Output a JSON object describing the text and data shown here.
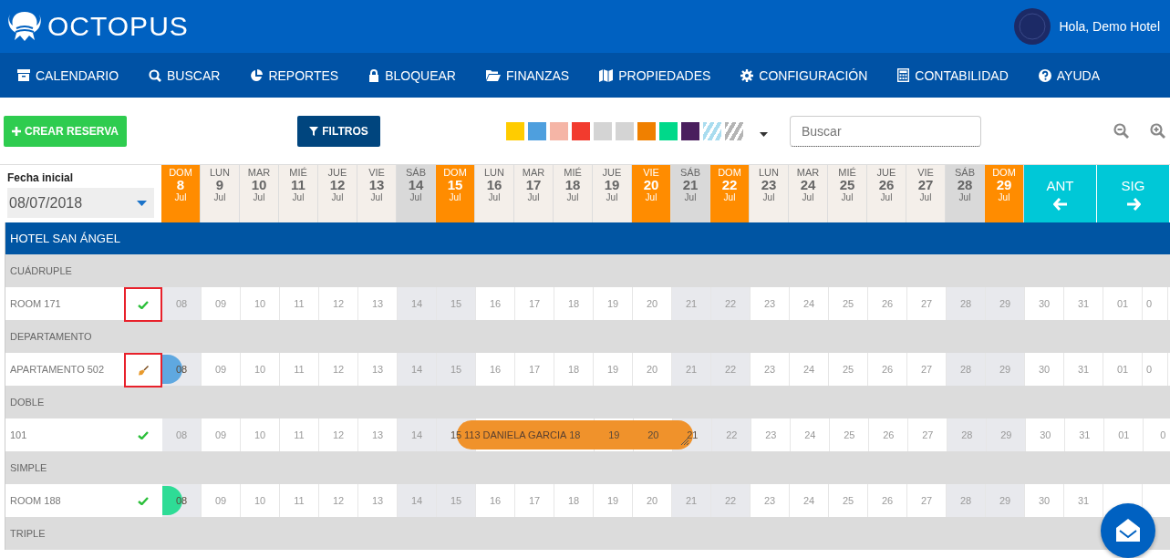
{
  "header": {
    "brand": "OCTOPUS",
    "greeting": "Hola, Demo Hotel"
  },
  "nav": [
    {
      "label": "CALENDARIO"
    },
    {
      "label": "BUSCAR"
    },
    {
      "label": "REPORTES"
    },
    {
      "label": "BLOQUEAR"
    },
    {
      "label": "FINANZAS"
    },
    {
      "label": "PROPIEDADES"
    },
    {
      "label": "CONFIGURACIÓN"
    },
    {
      "label": "CONTABILIDAD"
    },
    {
      "label": "AYUDA"
    }
  ],
  "toolbar": {
    "create_button": "CREAR RESERVA",
    "filter_button": "FILTROS",
    "search": {
      "placeholder": "Buscar"
    },
    "swatches": [
      {
        "kind": "solid",
        "color": "#ffcc00"
      },
      {
        "kind": "solid",
        "color": "#4e9fde"
      },
      {
        "kind": "solid",
        "color": "#f5b5a6"
      },
      {
        "kind": "solid",
        "color": "#f23b2e"
      },
      {
        "kind": "solid",
        "color": "#d4d4d4"
      },
      {
        "kind": "solid",
        "color": "#d4d4d4"
      },
      {
        "kind": "solid",
        "color": "#f08000"
      },
      {
        "kind": "solid",
        "color": "#00d98a"
      },
      {
        "kind": "solid",
        "color": "#4a1f5e"
      },
      {
        "kind": "striped",
        "color": "#a9dcef"
      },
      {
        "kind": "striped",
        "color": "#b4b4b4"
      }
    ]
  },
  "date_picker": {
    "label": "Fecha inicial",
    "value": "08/07/2018"
  },
  "days": [
    {
      "weekday": "DOM",
      "day": "8",
      "month": "Jul",
      "kind": "sunday"
    },
    {
      "weekday": "LUN",
      "day": "9",
      "month": "Jul",
      "kind": "weekday"
    },
    {
      "weekday": "MAR",
      "day": "10",
      "month": "Jul",
      "kind": "weekday"
    },
    {
      "weekday": "MIÉ",
      "day": "11",
      "month": "Jul",
      "kind": "weekday"
    },
    {
      "weekday": "JUE",
      "day": "12",
      "month": "Jul",
      "kind": "weekday"
    },
    {
      "weekday": "VIE",
      "day": "13",
      "month": "Jul",
      "kind": "weekday"
    },
    {
      "weekday": "SÁB",
      "day": "14",
      "month": "Jul",
      "kind": "saturday"
    },
    {
      "weekday": "DOM",
      "day": "15",
      "month": "Jul",
      "kind": "sunday"
    },
    {
      "weekday": "LUN",
      "day": "16",
      "month": "Jul",
      "kind": "weekday"
    },
    {
      "weekday": "MAR",
      "day": "17",
      "month": "Jul",
      "kind": "weekday"
    },
    {
      "weekday": "MIÉ",
      "day": "18",
      "month": "Jul",
      "kind": "weekday"
    },
    {
      "weekday": "JUE",
      "day": "19",
      "month": "Jul",
      "kind": "weekday"
    },
    {
      "weekday": "VIE",
      "day": "20",
      "month": "Jul",
      "kind": "holiday"
    },
    {
      "weekday": "SÁB",
      "day": "21",
      "month": "Jul",
      "kind": "saturday"
    },
    {
      "weekday": "DOM",
      "day": "22",
      "month": "Jul",
      "kind": "sunday"
    },
    {
      "weekday": "LUN",
      "day": "23",
      "month": "Jul",
      "kind": "weekday"
    },
    {
      "weekday": "MAR",
      "day": "24",
      "month": "Jul",
      "kind": "weekday"
    },
    {
      "weekday": "MIÉ",
      "day": "25",
      "month": "Jul",
      "kind": "weekday"
    },
    {
      "weekday": "JUE",
      "day": "26",
      "month": "Jul",
      "kind": "weekday"
    },
    {
      "weekday": "VIE",
      "day": "27",
      "month": "Jul",
      "kind": "weekday"
    },
    {
      "weekday": "SÁB",
      "day": "28",
      "month": "Jul",
      "kind": "saturday"
    },
    {
      "weekday": "DOM",
      "day": "29",
      "month": "Jul",
      "kind": "sunday"
    }
  ],
  "prev_button": "ANT",
  "next_button": "SIG",
  "hotel": {
    "name": "HOTEL SAN ÁNGEL"
  },
  "groups": [
    {
      "category": "CUÁDRUPLE",
      "rooms": [
        {
          "name": "ROOM 171",
          "clean": true,
          "highlighted": true,
          "cells": [
            {
              "kind": "day",
              "text": "08",
              "shaded": true
            },
            {
              "kind": "day",
              "text": "09",
              "shaded": false
            },
            {
              "kind": "day",
              "text": "10",
              "shaded": false
            },
            {
              "kind": "day",
              "text": "11",
              "shaded": false
            },
            {
              "kind": "day",
              "text": "12",
              "shaded": false
            },
            {
              "kind": "day",
              "text": "13",
              "shaded": false
            },
            {
              "kind": "day",
              "text": "14",
              "shaded": true
            },
            {
              "kind": "day",
              "text": "15",
              "shaded": true
            },
            {
              "kind": "day",
              "text": "16",
              "shaded": false
            },
            {
              "kind": "day",
              "text": "17",
              "shaded": false
            },
            {
              "kind": "day",
              "text": "18",
              "shaded": false
            },
            {
              "kind": "day",
              "text": "19",
              "shaded": false
            },
            {
              "kind": "day",
              "text": "20",
              "shaded": false
            },
            {
              "kind": "day",
              "text": "21",
              "shaded": true
            },
            {
              "kind": "day",
              "text": "22",
              "shaded": true
            },
            {
              "kind": "day",
              "text": "23",
              "shaded": false
            },
            {
              "kind": "day",
              "text": "24",
              "shaded": false
            },
            {
              "kind": "day",
              "text": "25",
              "shaded": false
            },
            {
              "kind": "day",
              "text": "26",
              "shaded": false
            },
            {
              "kind": "day",
              "text": "27",
              "shaded": false
            },
            {
              "kind": "day",
              "text": "28",
              "shaded": true
            },
            {
              "kind": "day",
              "text": "29",
              "shaded": true
            },
            {
              "kind": "day",
              "text": "30",
              "shaded": false
            },
            {
              "kind": "day",
              "text": "31",
              "shaded": false
            },
            {
              "kind": "day",
              "text": "01",
              "shaded": false
            },
            {
              "kind": "day",
              "text": "0",
              "shaded": false
            }
          ]
        }
      ]
    },
    {
      "category": "DEPARTAMENTO",
      "rooms": [
        {
          "name": "APARTAMENTO 502",
          "clean": false,
          "highlighted": true,
          "cells": [
            {
              "kind": "booking",
              "color": "#5fa8e0",
              "from_before": true,
              "days": [
                {
                  "kind": "day",
                  "text": "08",
                  "shaded": true
                }
              ]
            },
            {
              "kind": "day",
              "text": "09",
              "shaded": false
            },
            {
              "kind": "day",
              "text": "10",
              "shaded": false
            },
            {
              "kind": "day",
              "text": "11",
              "shaded": false
            },
            {
              "kind": "day",
              "text": "12",
              "shaded": false
            },
            {
              "kind": "day",
              "text": "13",
              "shaded": false
            },
            {
              "kind": "day",
              "text": "14",
              "shaded": true
            },
            {
              "kind": "day",
              "text": "15",
              "shaded": true
            },
            {
              "kind": "day",
              "text": "16",
              "shaded": false
            },
            {
              "kind": "day",
              "text": "17",
              "shaded": false
            },
            {
              "kind": "day",
              "text": "18",
              "shaded": false
            },
            {
              "kind": "day",
              "text": "19",
              "shaded": false
            },
            {
              "kind": "day",
              "text": "20",
              "shaded": false
            },
            {
              "kind": "day",
              "text": "21",
              "shaded": true
            },
            {
              "kind": "day",
              "text": "22",
              "shaded": true
            },
            {
              "kind": "day",
              "text": "23",
              "shaded": false
            },
            {
              "kind": "day",
              "text": "24",
              "shaded": false
            },
            {
              "kind": "day",
              "text": "25",
              "shaded": false
            },
            {
              "kind": "day",
              "text": "26",
              "shaded": false
            },
            {
              "kind": "day",
              "text": "27",
              "shaded": false
            },
            {
              "kind": "day",
              "text": "28",
              "shaded": true
            },
            {
              "kind": "day",
              "text": "29",
              "shaded": true
            },
            {
              "kind": "day",
              "text": "30",
              "shaded": false
            },
            {
              "kind": "day",
              "text": "31",
              "shaded": false
            },
            {
              "kind": "day",
              "text": "01",
              "shaded": false
            },
            {
              "kind": "day",
              "text": "0",
              "shaded": false
            }
          ]
        }
      ]
    },
    {
      "category": "DOBLE",
      "rooms": [
        {
          "name": "101",
          "clean": true,
          "highlighted": false,
          "cells": [
            {
              "kind": "day",
              "text": "08",
              "shaded": true
            },
            {
              "kind": "day",
              "text": "09",
              "shaded": false
            },
            {
              "kind": "day",
              "text": "10",
              "shaded": false
            },
            {
              "kind": "day",
              "text": "11",
              "shaded": false
            },
            {
              "kind": "day",
              "text": "12",
              "shaded": false
            },
            {
              "kind": "day",
              "text": "13",
              "shaded": false
            },
            {
              "kind": "day",
              "text": "14",
              "shaded": true
            },
            {
              "kind": "booking",
              "color": "#f0922b",
              "from_before": false,
              "days": [
                {
                  "kind": "day",
                  "text": "15",
                  "shaded": true
                },
                {
                  "kind": "label",
                  "text": "113 DANIELA GARCIA"
                },
                {
                  "kind": "day",
                  "text": "18"
                },
                {
                  "kind": "day",
                  "text": "19"
                },
                {
                  "kind": "day",
                  "text": "20"
                },
                {
                  "kind": "day",
                  "text": "21",
                  "shaded": true
                }
              ]
            },
            {
              "kind": "day",
              "text": "22",
              "shaded": true
            },
            {
              "kind": "day",
              "text": "23",
              "shaded": false
            },
            {
              "kind": "day",
              "text": "24",
              "shaded": false
            },
            {
              "kind": "day",
              "text": "25",
              "shaded": false
            },
            {
              "kind": "day",
              "text": "26",
              "shaded": false
            },
            {
              "kind": "day",
              "text": "27",
              "shaded": false
            },
            {
              "kind": "day",
              "text": "28",
              "shaded": true
            },
            {
              "kind": "day",
              "text": "29",
              "shaded": true
            },
            {
              "kind": "day",
              "text": "30",
              "shaded": false
            },
            {
              "kind": "day",
              "text": "31",
              "shaded": false
            },
            {
              "kind": "day",
              "text": "01",
              "shaded": false
            },
            {
              "kind": "day",
              "text": "0",
              "shaded": false
            }
          ]
        }
      ]
    },
    {
      "category": "SIMPLE",
      "rooms": [
        {
          "name": "ROOM 188",
          "clean": true,
          "highlighted": false,
          "cells": [
            {
              "kind": "booking",
              "color": "#2edc96",
              "from_before": true,
              "days": [
                {
                  "kind": "day",
                  "text": "08",
                  "shaded": true
                }
              ]
            },
            {
              "kind": "day",
              "text": "09",
              "shaded": false
            },
            {
              "kind": "day",
              "text": "10",
              "shaded": false
            },
            {
              "kind": "day",
              "text": "11",
              "shaded": false
            },
            {
              "kind": "day",
              "text": "12",
              "shaded": false
            },
            {
              "kind": "day",
              "text": "13",
              "shaded": false
            },
            {
              "kind": "day",
              "text": "14",
              "shaded": true
            },
            {
              "kind": "day",
              "text": "15",
              "shaded": true
            },
            {
              "kind": "day",
              "text": "16",
              "shaded": false
            },
            {
              "kind": "day",
              "text": "17",
              "shaded": false
            },
            {
              "kind": "day",
              "text": "18",
              "shaded": false
            },
            {
              "kind": "day",
              "text": "19",
              "shaded": false
            },
            {
              "kind": "day",
              "text": "20",
              "shaded": false
            },
            {
              "kind": "day",
              "text": "21",
              "shaded": true
            },
            {
              "kind": "day",
              "text": "22",
              "shaded": true
            },
            {
              "kind": "day",
              "text": "23",
              "shaded": false
            },
            {
              "kind": "day",
              "text": "24",
              "shaded": false
            },
            {
              "kind": "day",
              "text": "25",
              "shaded": false
            },
            {
              "kind": "day",
              "text": "26",
              "shaded": false
            },
            {
              "kind": "day",
              "text": "27",
              "shaded": false
            },
            {
              "kind": "day",
              "text": "28",
              "shaded": true
            },
            {
              "kind": "day",
              "text": "29",
              "shaded": true
            },
            {
              "kind": "day",
              "text": "30",
              "shaded": false
            },
            {
              "kind": "day",
              "text": "31",
              "shaded": false
            },
            {
              "kind": "day"
            }
          ]
        }
      ]
    },
    {
      "category": "TRIPLE"
    }
  ]
}
